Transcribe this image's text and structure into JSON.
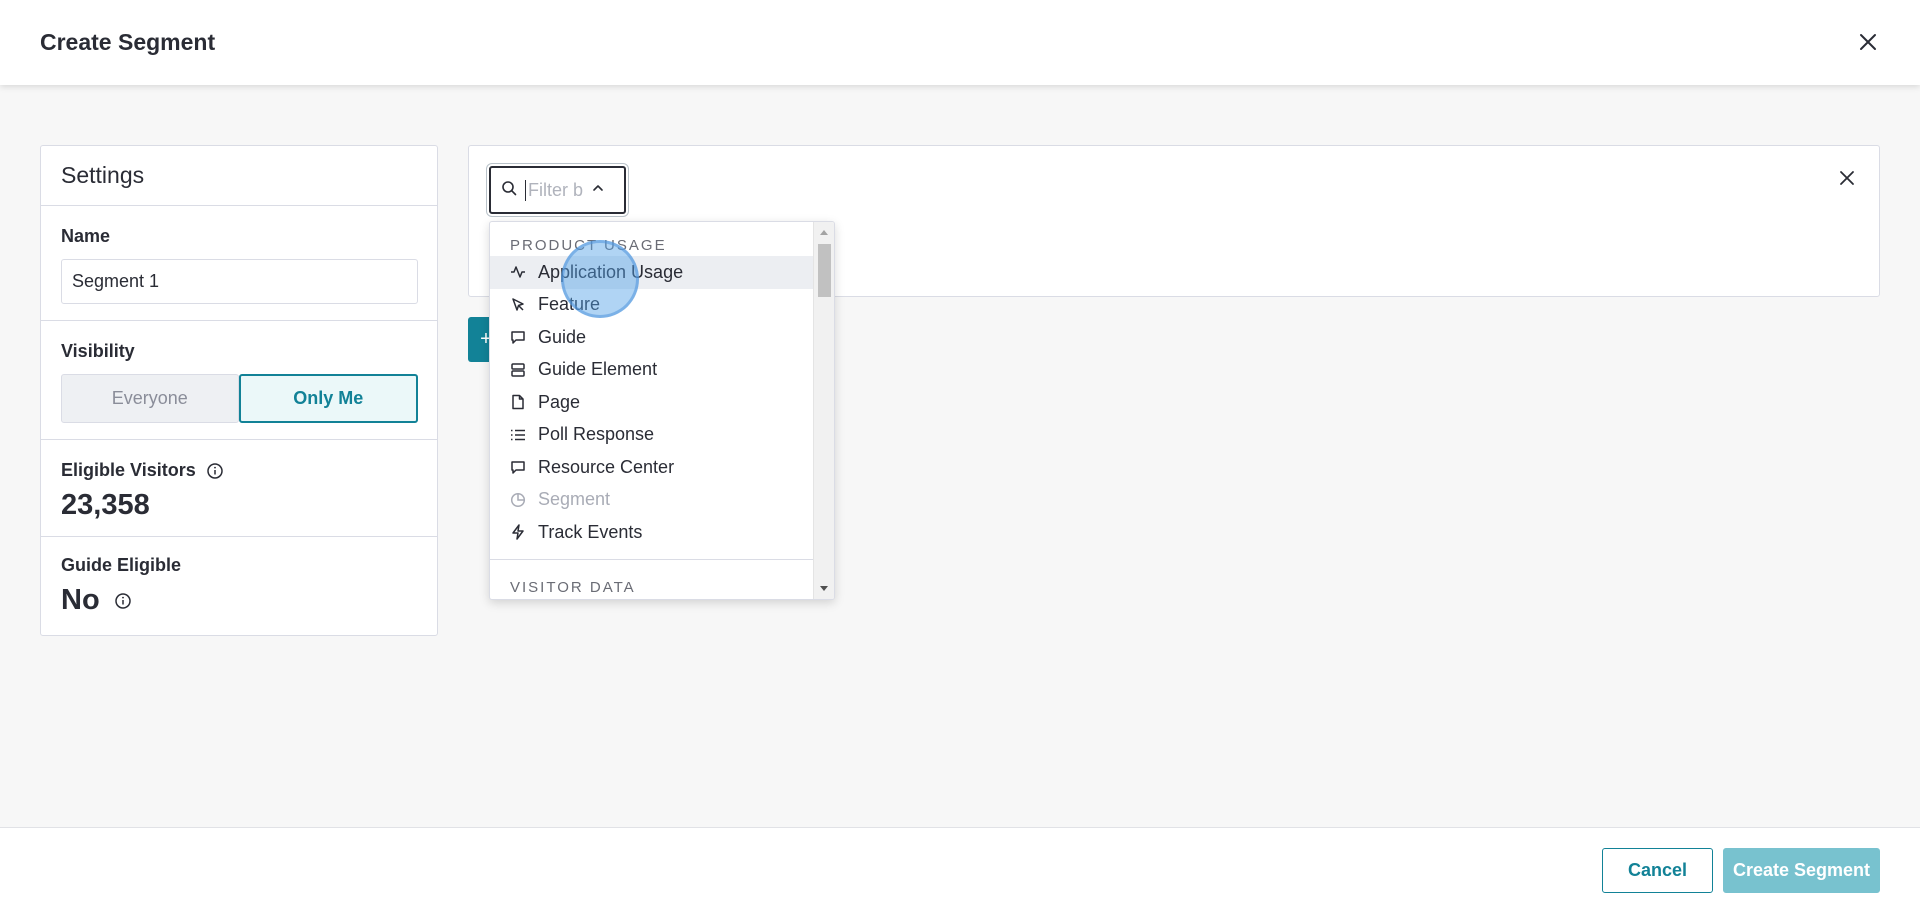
{
  "header": {
    "title": "Create Segment",
    "close_icon": "close-icon"
  },
  "settings": {
    "title": "Settings",
    "name_label": "Name",
    "name_value": "Segment 1",
    "visibility_label": "Visibility",
    "visibility_options": [
      "Everyone",
      "Only Me"
    ],
    "visibility_selected": "Only Me",
    "eligible_visitors_label": "Eligible Visitors",
    "eligible_visitors_value": "23,358",
    "guide_eligible_label": "Guide Eligible",
    "guide_eligible_value": "No"
  },
  "filter": {
    "placeholder": "Filter by",
    "add_label": "+"
  },
  "dropdown": {
    "groups": [
      {
        "label": "PRODUCT USAGE",
        "items": [
          {
            "label": "Application Usage",
            "icon": "activity-icon",
            "active": true
          },
          {
            "label": "Feature",
            "icon": "pointer-icon"
          },
          {
            "label": "Guide",
            "icon": "message-icon"
          },
          {
            "label": "Guide Element",
            "icon": "layers-icon"
          },
          {
            "label": "Page",
            "icon": "file-icon"
          },
          {
            "label": "Poll Response",
            "icon": "list-icon"
          },
          {
            "label": "Resource Center",
            "icon": "message-icon"
          },
          {
            "label": "Segment",
            "icon": "pie-icon",
            "disabled": true
          },
          {
            "label": "Track Events",
            "icon": "zap-icon"
          }
        ]
      },
      {
        "label": "VISITOR DATA",
        "items": []
      }
    ]
  },
  "footer": {
    "cancel_label": "Cancel",
    "create_label": "Create Segment"
  },
  "colors": {
    "accent": "#128297",
    "accent_disabled": "#78c2cf",
    "text": "#2a2c35",
    "border": "#dadce5"
  }
}
